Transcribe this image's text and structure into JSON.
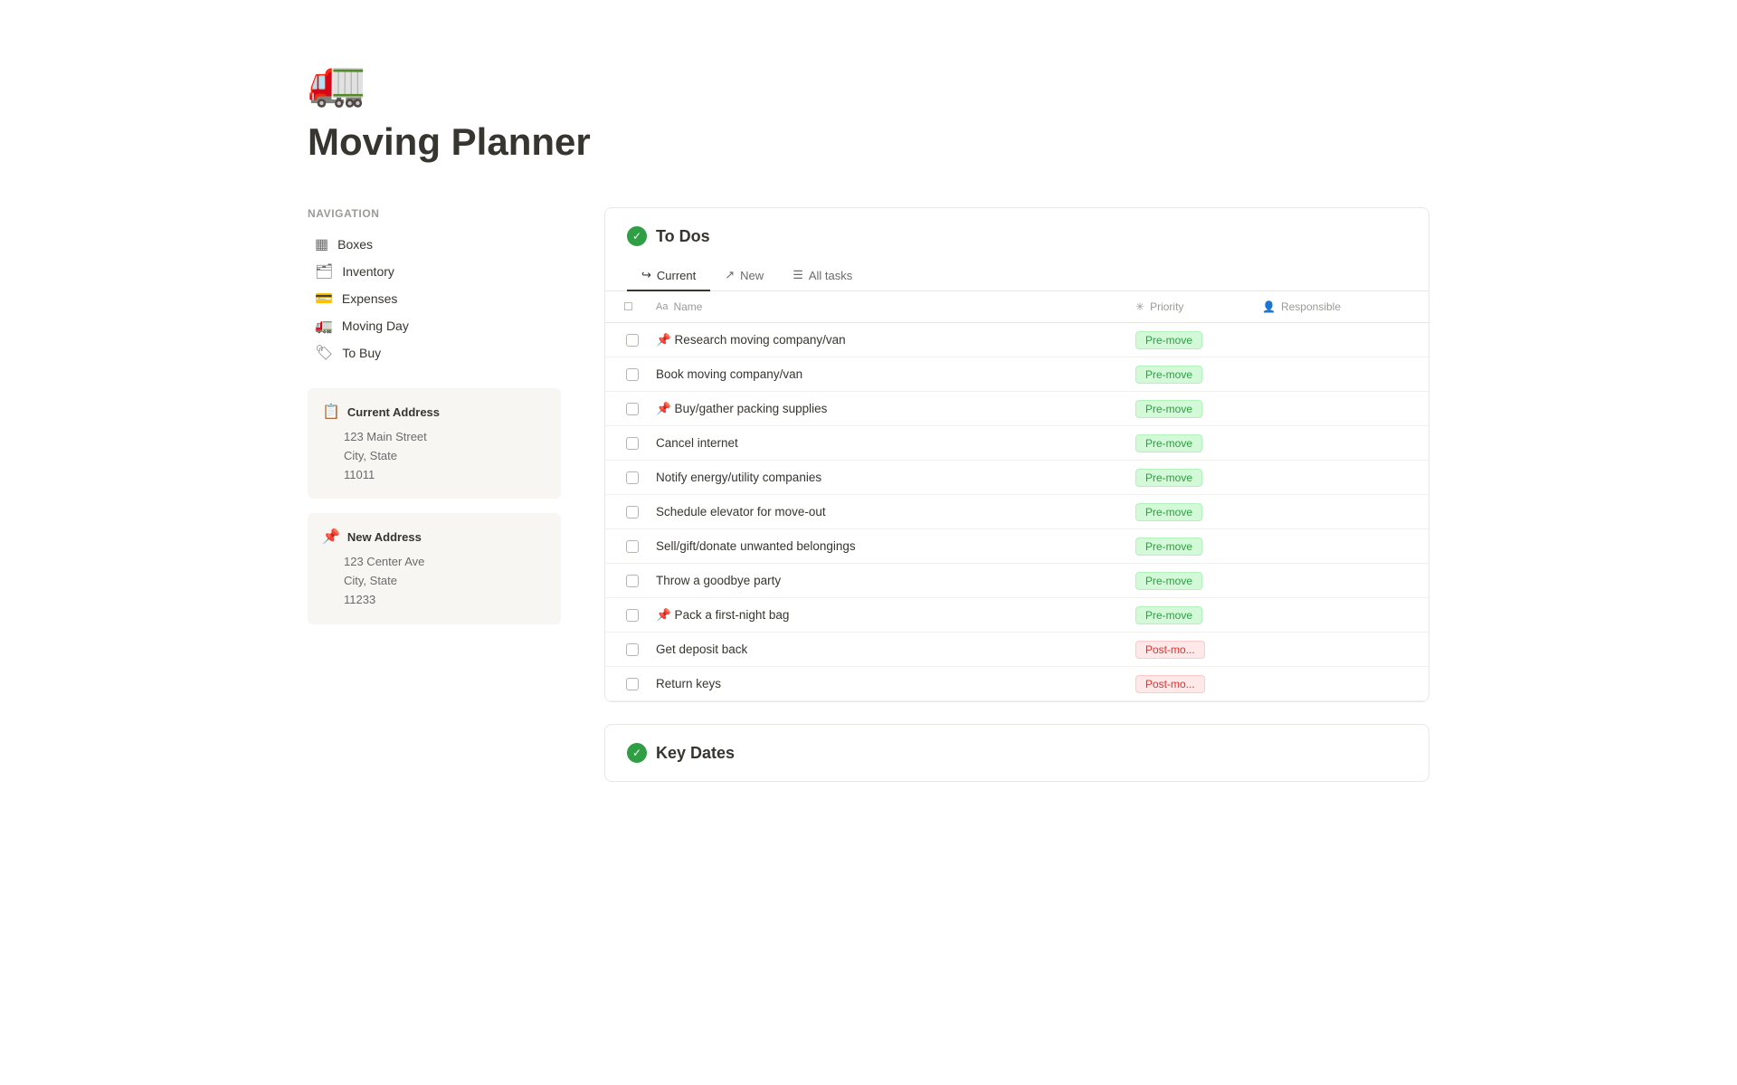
{
  "page": {
    "icon": "🚛",
    "title": "Moving Planner"
  },
  "navigation": {
    "heading": "Navigation",
    "items": [
      {
        "id": "boxes",
        "icon": "▦",
        "label": "Boxes"
      },
      {
        "id": "inventory",
        "icon": "🗂",
        "label": "Inventory"
      },
      {
        "id": "expenses",
        "icon": "💳",
        "label": "Expenses"
      },
      {
        "id": "moving-day",
        "icon": "🚛",
        "label": "Moving Day"
      },
      {
        "id": "to-buy",
        "icon": "🏷",
        "label": "To Buy"
      }
    ]
  },
  "current_address": {
    "title": "Current Address",
    "line1": "123 Main Street",
    "line2": "City, State",
    "line3": "11011"
  },
  "new_address": {
    "title": "New Address",
    "line1": "123 Center Ave",
    "line2": "City, State",
    "line3": "11233"
  },
  "todos": {
    "section_title": "To Dos",
    "tabs": [
      {
        "id": "current",
        "icon": "↪",
        "label": "Current",
        "active": true
      },
      {
        "id": "new",
        "icon": "↗",
        "label": "New",
        "active": false
      },
      {
        "id": "all-tasks",
        "icon": "☰",
        "label": "All tasks",
        "active": false
      }
    ],
    "col_headers": [
      {
        "id": "check",
        "icon": "",
        "label": ""
      },
      {
        "id": "name",
        "icon": "Aa",
        "label": "Name"
      },
      {
        "id": "priority",
        "icon": "✳",
        "label": "Priority"
      },
      {
        "id": "responsible",
        "icon": "👤",
        "label": "Responsible"
      }
    ],
    "rows": [
      {
        "id": 1,
        "name": "📌 Research moving company/van",
        "priority": "Pre-move",
        "priority_type": "pre",
        "responsible": ""
      },
      {
        "id": 2,
        "name": "Book moving company/van",
        "priority": "Pre-move",
        "priority_type": "pre",
        "responsible": ""
      },
      {
        "id": 3,
        "name": "📌 Buy/gather packing supplies",
        "priority": "Pre-move",
        "priority_type": "pre",
        "responsible": ""
      },
      {
        "id": 4,
        "name": "Cancel internet",
        "priority": "Pre-move",
        "priority_type": "pre",
        "responsible": ""
      },
      {
        "id": 5,
        "name": "Notify energy/utility companies",
        "priority": "Pre-move",
        "priority_type": "pre",
        "responsible": ""
      },
      {
        "id": 6,
        "name": "Schedule elevator for move-out",
        "priority": "Pre-move",
        "priority_type": "pre",
        "responsible": ""
      },
      {
        "id": 7,
        "name": "Sell/gift/donate unwanted belongings",
        "priority": "Pre-move",
        "priority_type": "pre",
        "responsible": ""
      },
      {
        "id": 8,
        "name": "Throw a goodbye party",
        "priority": "Pre-move",
        "priority_type": "pre",
        "responsible": ""
      },
      {
        "id": 9,
        "name": "📌 Pack a first-night bag",
        "priority": "Pre-move",
        "priority_type": "pre",
        "responsible": ""
      },
      {
        "id": 10,
        "name": "Get deposit back",
        "priority": "Post-mo...",
        "priority_type": "post",
        "responsible": ""
      },
      {
        "id": 11,
        "name": "Return keys",
        "priority": "Post-mo...",
        "priority_type": "post",
        "responsible": ""
      }
    ]
  },
  "key_dates": {
    "section_title": "Key Dates"
  }
}
